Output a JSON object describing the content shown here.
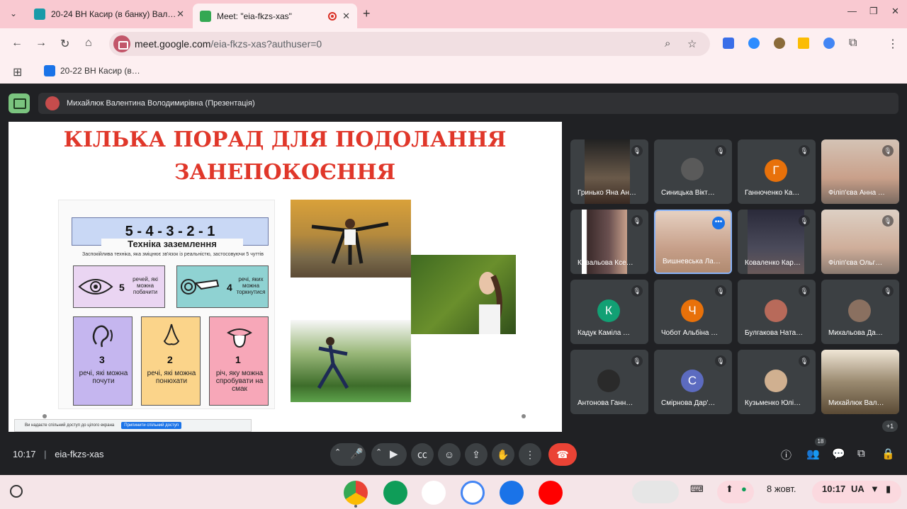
{
  "browser": {
    "tabs": [
      {
        "title": "20-24 ВН Касир (в банку) Вал…",
        "favicon_color": "#1a9aa8"
      },
      {
        "title": "Meet: \"eia-fkzs-xas\"",
        "favicon_color": "#34a853",
        "recording": true
      }
    ],
    "url_domain": "meet.google.com",
    "url_path": "/eia-fkzs-xas?authuser=0",
    "bookmark": "20-22 ВН Касир (в…"
  },
  "meet": {
    "presenter_banner": "Михайлюк Валентина Володимирівна (Презентація)",
    "slide": {
      "title_line1": "КІЛЬКА ПОРАД ДЛЯ ПОДОЛАННЯ",
      "title_line2": "ЗАНЕПОКОЄННЯ",
      "poster_head": "5 - 4 - 3 - 2 - 1",
      "poster_sub": "Техніка заземлення",
      "poster_desc": "Заспокійлива техніка, яка зміцнює зв'язок із реальністю, застосовуючи 5 чуттів",
      "boxes": [
        {
          "num": "5",
          "label": "речей, які можна побачити",
          "color": "#ead5f2"
        },
        {
          "num": "4",
          "label": "речі, яких можна торкнутися",
          "color": "#8fd2d2"
        },
        {
          "num": "3",
          "label": "речі, які можна почути",
          "color": "#c5b6ef"
        },
        {
          "num": "2",
          "label": "речі, які можна понюхати",
          "color": "#fbd48a"
        },
        {
          "num": "1",
          "label": "річ, яку можна спробувати на смак",
          "color": "#f7a7b8"
        }
      ],
      "share_notice": "Ви надаєте спільний доступ до цілого екрана",
      "stop_share": "Припинити спільний доступ"
    },
    "participants": [
      {
        "name": "Гринько Яна Ан…",
        "type": "video",
        "color": "#6a5a4a"
      },
      {
        "name": "Синицька Вікт…",
        "type": "photo",
        "color": "#5a5a5a"
      },
      {
        "name": "Ганноченко Ка…",
        "type": "letter",
        "letter": "Г",
        "color": "#e8710a"
      },
      {
        "name": "Філіп'єва Анна …",
        "type": "video",
        "color": "#c9a08a"
      },
      {
        "name": "Ковальова Ксе…",
        "type": "video",
        "color": "#4a3a3a"
      },
      {
        "name": "Вишневська Ла…",
        "type": "video",
        "color": "#c7a08a",
        "active": true
      },
      {
        "name": "Коваленко Кар…",
        "type": "video",
        "color": "#4a4a5a"
      },
      {
        "name": "Філіп'єва Ольг…",
        "type": "video",
        "color": "#cfae9a"
      },
      {
        "name": "Кадук Каміла …",
        "type": "letter",
        "letter": "К",
        "color": "#12a074"
      },
      {
        "name": "Чобот Альбіна …",
        "type": "letter",
        "letter": "Ч",
        "color": "#e8710a"
      },
      {
        "name": "Булгакова Ната…",
        "type": "photo",
        "color": "#b86a5a"
      },
      {
        "name": "Михальова Да…",
        "type": "photo",
        "color": "#8a7060"
      },
      {
        "name": "Антонова Ганн…",
        "type": "photo",
        "color": "#2a2a2a"
      },
      {
        "name": "Смірнова Дар'…",
        "type": "letter",
        "letter": "С",
        "color": "#5c6bc0"
      },
      {
        "name": "Кузьменко Юлі…",
        "type": "photo",
        "color": "#d0b090"
      },
      {
        "name": "Михайлюк Вал…",
        "type": "video",
        "color": "#7a6a50"
      }
    ],
    "overflow_count": "+1",
    "time": "10:17",
    "meeting_code": "eia-fkzs-xas",
    "people_count": "18"
  },
  "shelf": {
    "date": "8 жовт.",
    "time": "10:17",
    "lang": "UA"
  }
}
